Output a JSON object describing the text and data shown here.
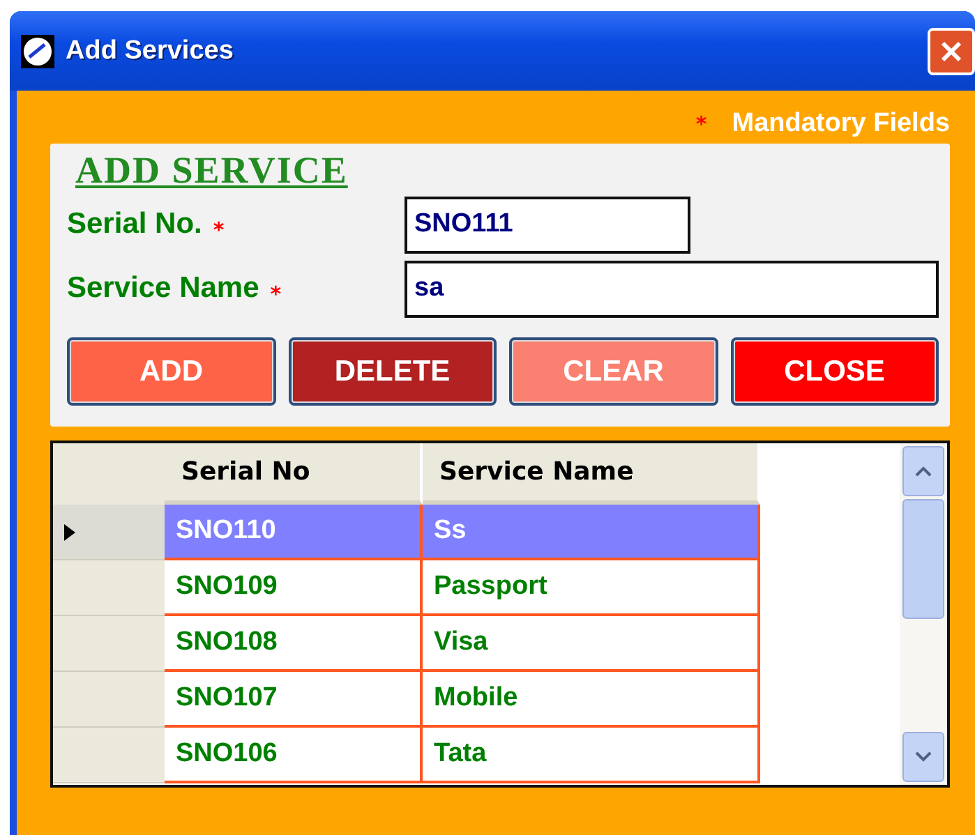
{
  "window": {
    "title": "Add Services"
  },
  "mandatory_note": {
    "mark": "*",
    "text": "Mandatory Fields"
  },
  "group": {
    "title": "ADD SERVICE",
    "fields": [
      {
        "label": "Serial No.",
        "mark": "*",
        "value": "SNO111",
        "wide": false
      },
      {
        "label": "Service Name",
        "mark": "*",
        "value": "sa",
        "wide": true
      }
    ],
    "buttons": [
      {
        "label": "ADD",
        "color": "#ff6347"
      },
      {
        "label": "DELETE",
        "color": "#b22222"
      },
      {
        "label": "CLEAR",
        "color": "#fa8072"
      },
      {
        "label": "CLOSE",
        "color": "#ff0000"
      }
    ]
  },
  "table": {
    "columns": [
      "Serial No",
      "Service Name"
    ],
    "rows": [
      {
        "cells": [
          "SNO110",
          "Ss"
        ],
        "selected": true
      },
      {
        "cells": [
          "SNO109",
          "Passport"
        ],
        "selected": false
      },
      {
        "cells": [
          "SNO108",
          "Visa"
        ],
        "selected": false
      },
      {
        "cells": [
          "SNO107",
          "Mobile"
        ],
        "selected": false
      },
      {
        "cells": [
          "SNO106",
          "Tata"
        ],
        "selected": false
      }
    ]
  }
}
